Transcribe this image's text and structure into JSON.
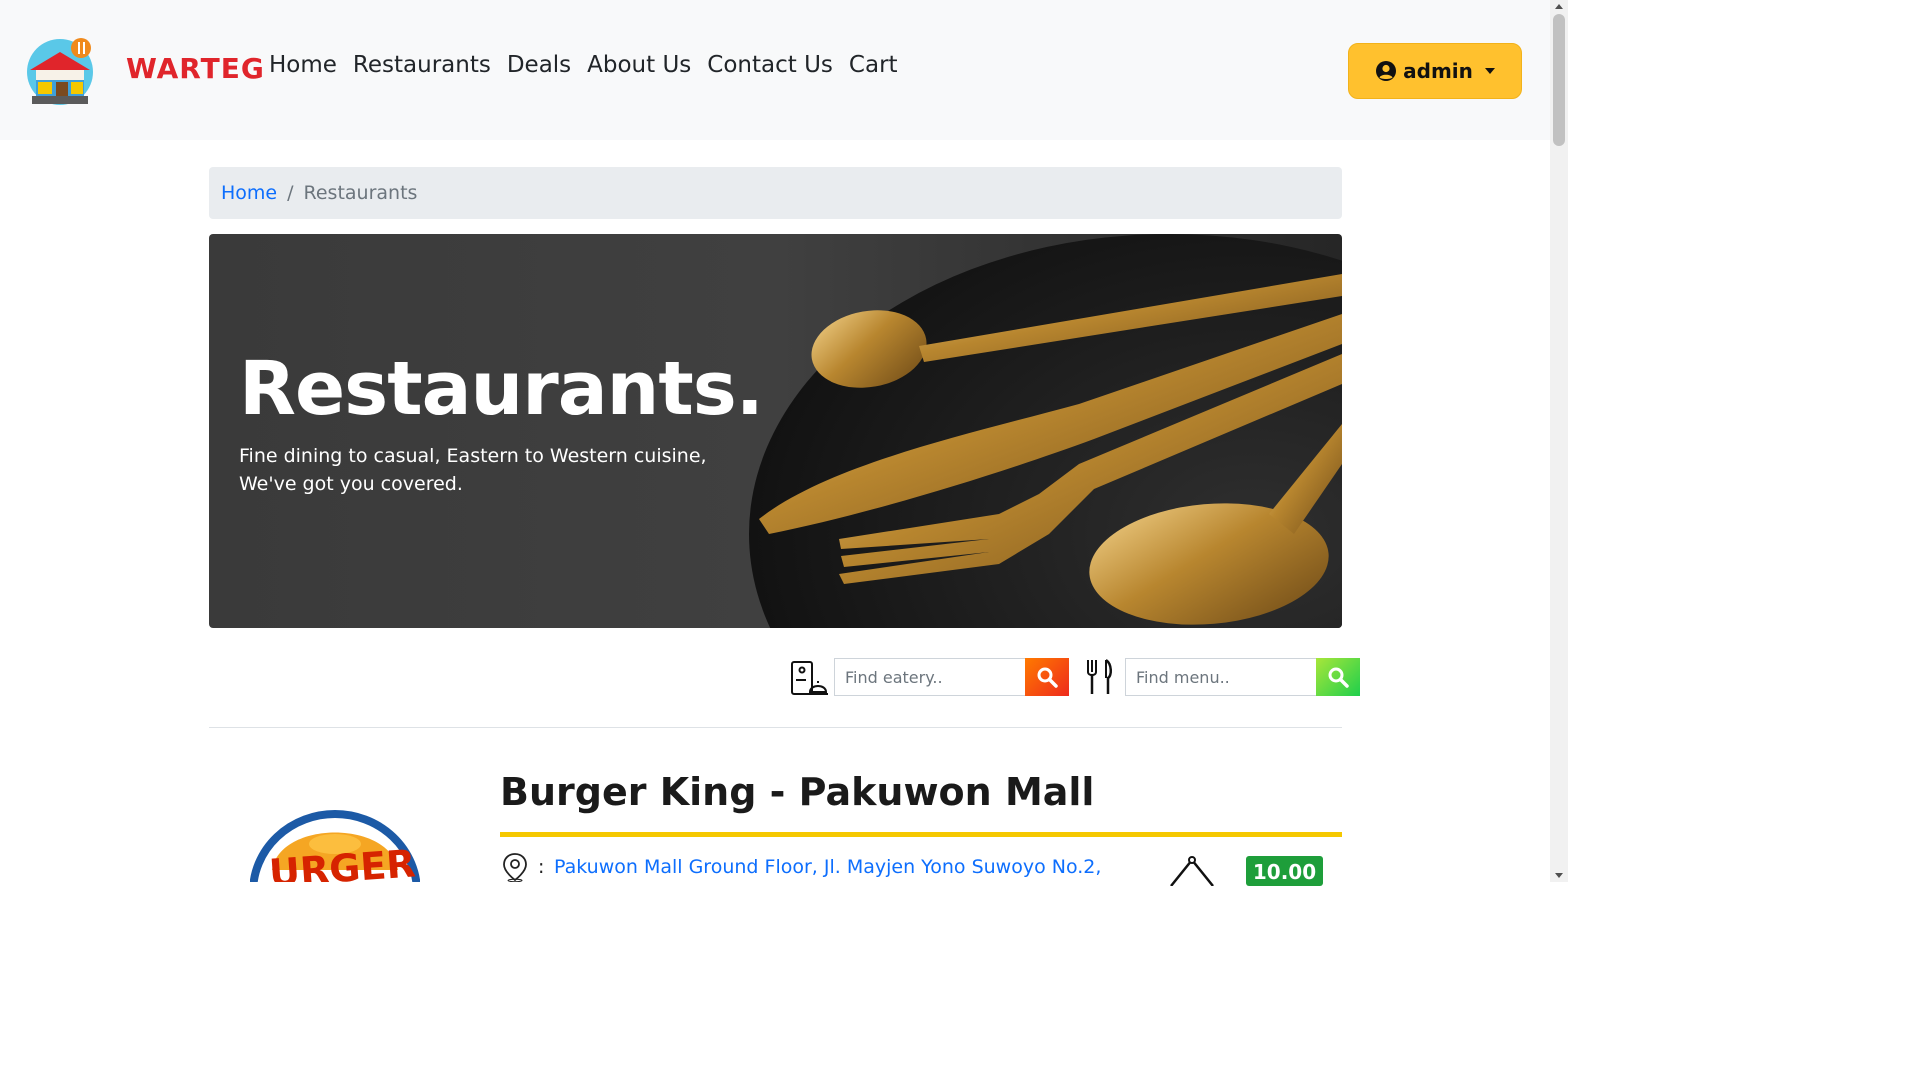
{
  "brand": {
    "name": "WARTEG",
    "accent": "#e0252b"
  },
  "nav": {
    "links": [
      {
        "label": "Home"
      },
      {
        "label": "Restaurants"
      },
      {
        "label": "Deals"
      },
      {
        "label": "About Us"
      },
      {
        "label": "Contact Us"
      },
      {
        "label": "Cart"
      }
    ]
  },
  "user": {
    "name": "admin",
    "icon": "user-circle-icon",
    "color": "#ffc12e"
  },
  "breadcrumb": {
    "home": "Home",
    "current": "Restaurants"
  },
  "hero": {
    "title": "Restaurants.",
    "subtitle": "Fine dining to casual, Eastern to Western cuisine, We've got you covered."
  },
  "search": {
    "eatery_placeholder": "Find eatery..",
    "menu_placeholder": "Find menu..",
    "eatery_icon": "eatery-icon",
    "menu_icon": "fork-knife-icon"
  },
  "restaurant": {
    "name": "Burger King - Pakuwon Mall",
    "colon": ":",
    "address": "Pakuwon Mall Ground Floor, Jl. Mayjen Yono Suwoyo No.2,",
    "rating": "10.00",
    "rating_color": "#1e9e3a"
  }
}
